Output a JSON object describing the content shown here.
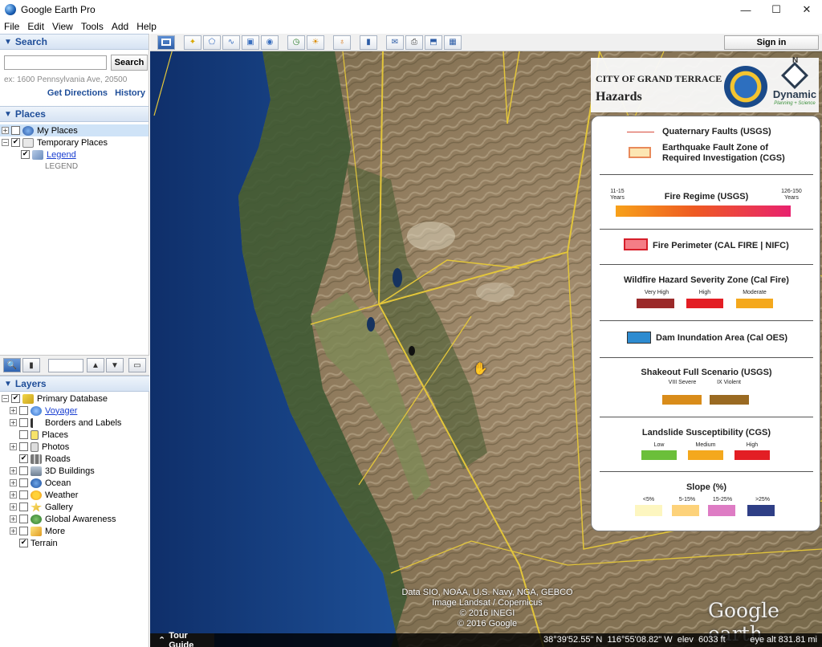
{
  "window": {
    "title": "Google Earth Pro",
    "controls": [
      "—",
      "☐",
      "✕"
    ]
  },
  "menu": [
    "File",
    "Edit",
    "View",
    "Tools",
    "Add",
    "Help"
  ],
  "search_panel": {
    "header": "Search",
    "button": "Search",
    "input_value": "",
    "hint": "ex: 1600 Pennsylvania Ave, 20500",
    "links": [
      "Get Directions",
      "History"
    ]
  },
  "places_panel": {
    "header": "Places",
    "items": [
      {
        "label": "My Places",
        "checked": false
      },
      {
        "label": "Temporary Places",
        "checked": true
      },
      {
        "label": "Legend",
        "checked": true
      },
      {
        "label": "LEGEND"
      }
    ]
  },
  "layers_panel": {
    "header": "Layers",
    "items": [
      {
        "label": "Primary Database",
        "checked": true
      },
      {
        "label": "Voyager",
        "checked": false
      },
      {
        "label": "Borders and Labels",
        "checked": false
      },
      {
        "label": "Places",
        "checked": false
      },
      {
        "label": "Photos",
        "checked": false
      },
      {
        "label": "Roads",
        "checked": true
      },
      {
        "label": "3D Buildings",
        "checked": false
      },
      {
        "label": "Ocean",
        "checked": false
      },
      {
        "label": "Weather",
        "checked": false
      },
      {
        "label": "Gallery",
        "checked": false
      },
      {
        "label": "Global Awareness",
        "checked": false
      },
      {
        "label": "More",
        "checked": false
      },
      {
        "label": "Terrain",
        "checked": true
      }
    ]
  },
  "toolbar": {
    "signin": "Sign in"
  },
  "map": {
    "attribution": [
      "Data SIO, NOAA, U.S. Navy, NGA, GEBCO",
      "Image Landsat / Copernicus",
      "© 2016 INEGI",
      "© 2016 Google"
    ],
    "logo": "Google earth",
    "tour_guide": "Tour Guide",
    "coords": "38°39'52.55\" N  116°55'08.82\" W  elev  6033 ft          eye alt 831.81 mi"
  },
  "legend": {
    "city": "CITY OF GRAND TERRACE",
    "title": "Hazards",
    "north": "N",
    "logo_word": "Dynamic",
    "logo_tag": "Planning + Science",
    "faults": "Quaternary Faults (USGS)",
    "fault_zone": "Earthquake Fault Zone of Required Investigation (CGS)",
    "fire_regime": {
      "title": "Fire Regime (USGS)",
      "min": "11-15 Years",
      "max": "126-150 Years"
    },
    "fire_perimeter": "Fire Perimeter (CAL FIRE | NIFC)",
    "wildfire": {
      "title": "Wildfire Hazard Severity Zone (Cal Fire)",
      "labels": [
        "Very High",
        "High",
        "Moderate"
      ],
      "colors": [
        "#9b2a2a",
        "#e31e24",
        "#f4a81d"
      ]
    },
    "dam": "Dam Inundation Area (Cal OES)",
    "shakeout": {
      "title": "Shakeout Full Scenario (USGS)",
      "labels": [
        "VIII Severe",
        "IX Violent"
      ],
      "colors": [
        "#d98c1a",
        "#9a6a22"
      ]
    },
    "landslide": {
      "title": "Landslide Susceptibility (CGS)",
      "labels": [
        "Low",
        "Medium",
        "High"
      ],
      "colors": [
        "#6bbf3a",
        "#f4a81d",
        "#e31e24"
      ]
    },
    "slope": {
      "title": "Slope (%)",
      "labels": [
        "<5%",
        "5-15%",
        "15-25%",
        ">25%"
      ],
      "colors": [
        "#fdf6c0",
        "#fdd27a",
        "#de7cc4",
        "#2f3f86"
      ]
    }
  }
}
